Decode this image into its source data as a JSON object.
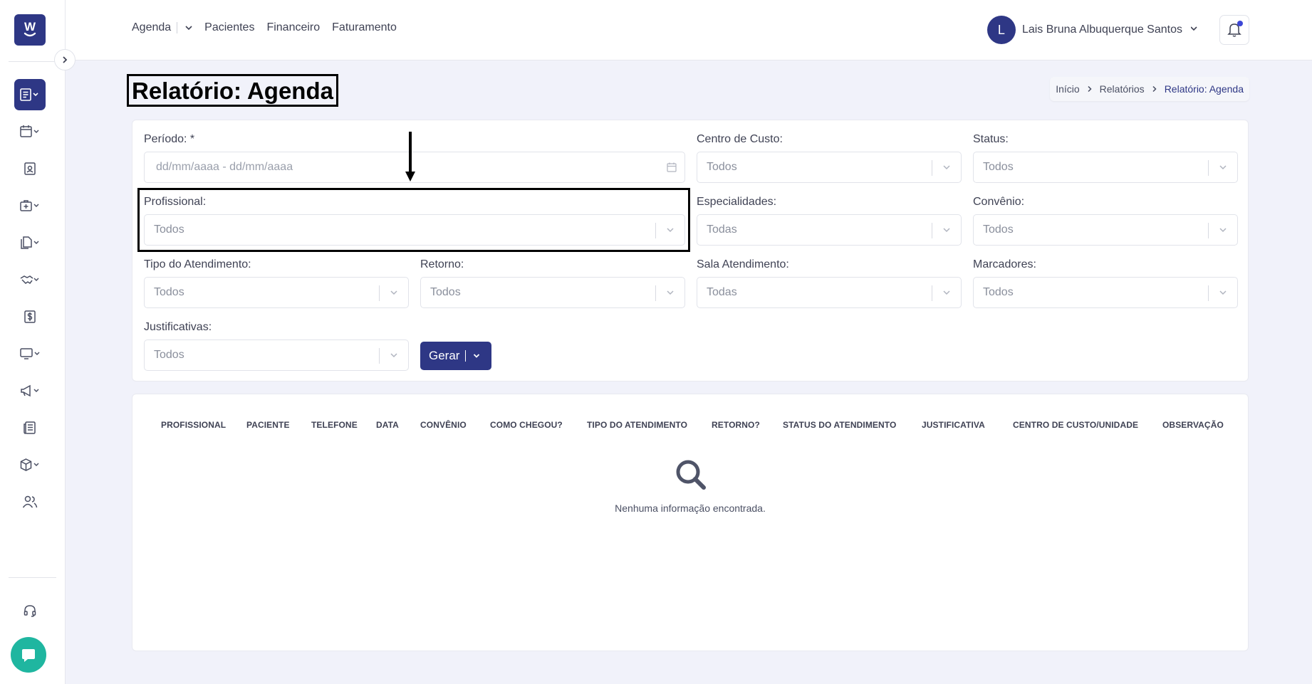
{
  "nav": {
    "items": [
      "Agenda",
      "Pacientes",
      "Financeiro",
      "Faturamento"
    ]
  },
  "user": {
    "initial": "L",
    "name": "Lais Bruna Albuquerque Santos"
  },
  "page": {
    "title": "Relatório: Agenda"
  },
  "breadcrumb": [
    "Início",
    "Relatórios",
    "Relatório: Agenda"
  ],
  "filters": {
    "periodo": {
      "label": "Período: *",
      "placeholder": "dd/mm/aaaa - dd/mm/aaaa"
    },
    "centro_custo": {
      "label": "Centro de Custo:",
      "value": "Todos"
    },
    "status": {
      "label": "Status:",
      "value": "Todos"
    },
    "profissional": {
      "label": "Profissional:",
      "value": "Todos"
    },
    "especialidades": {
      "label": "Especialidades:",
      "value": "Todas"
    },
    "convenio": {
      "label": "Convênio:",
      "value": "Todos"
    },
    "tipo_atendimento": {
      "label": "Tipo do Atendimento:",
      "value": "Todos"
    },
    "retorno": {
      "label": "Retorno:",
      "value": "Todos"
    },
    "sala_atendimento": {
      "label": "Sala Atendimento:",
      "value": "Todas"
    },
    "marcadores": {
      "label": "Marcadores:",
      "value": "Todos"
    },
    "justificativas": {
      "label": "Justificativas:",
      "value": "Todos"
    }
  },
  "actions": {
    "gerar_label": "Gerar"
  },
  "table": {
    "columns": [
      "PROFISSIONAL",
      "PACIENTE",
      "TELEFONE",
      "DATA",
      "CONVÊNIO",
      "COMO CHEGOU?",
      "TIPO DO ATENDIMENTO",
      "RETORNO?",
      "STATUS DO ATENDIMENTO",
      "JUSTIFICATIVA",
      "CENTRO DE CUSTO/UNIDADE",
      "OBSERVAÇÃO"
    ],
    "empty_message": "Nenhuma informação encontrada."
  },
  "colors": {
    "primary": "#2e3785",
    "chat": "#1fb6a0",
    "notification_dot": "#3d47d6"
  },
  "icons": {
    "sidebar": [
      "reports-icon",
      "calendar-icon",
      "patient-card-icon",
      "medical-bag-icon",
      "documents-icon",
      "handshake-icon",
      "finance-icon",
      "monitor-icon",
      "megaphone-icon",
      "newspaper-icon",
      "box-icon",
      "users-icon",
      "headset-icon"
    ]
  }
}
